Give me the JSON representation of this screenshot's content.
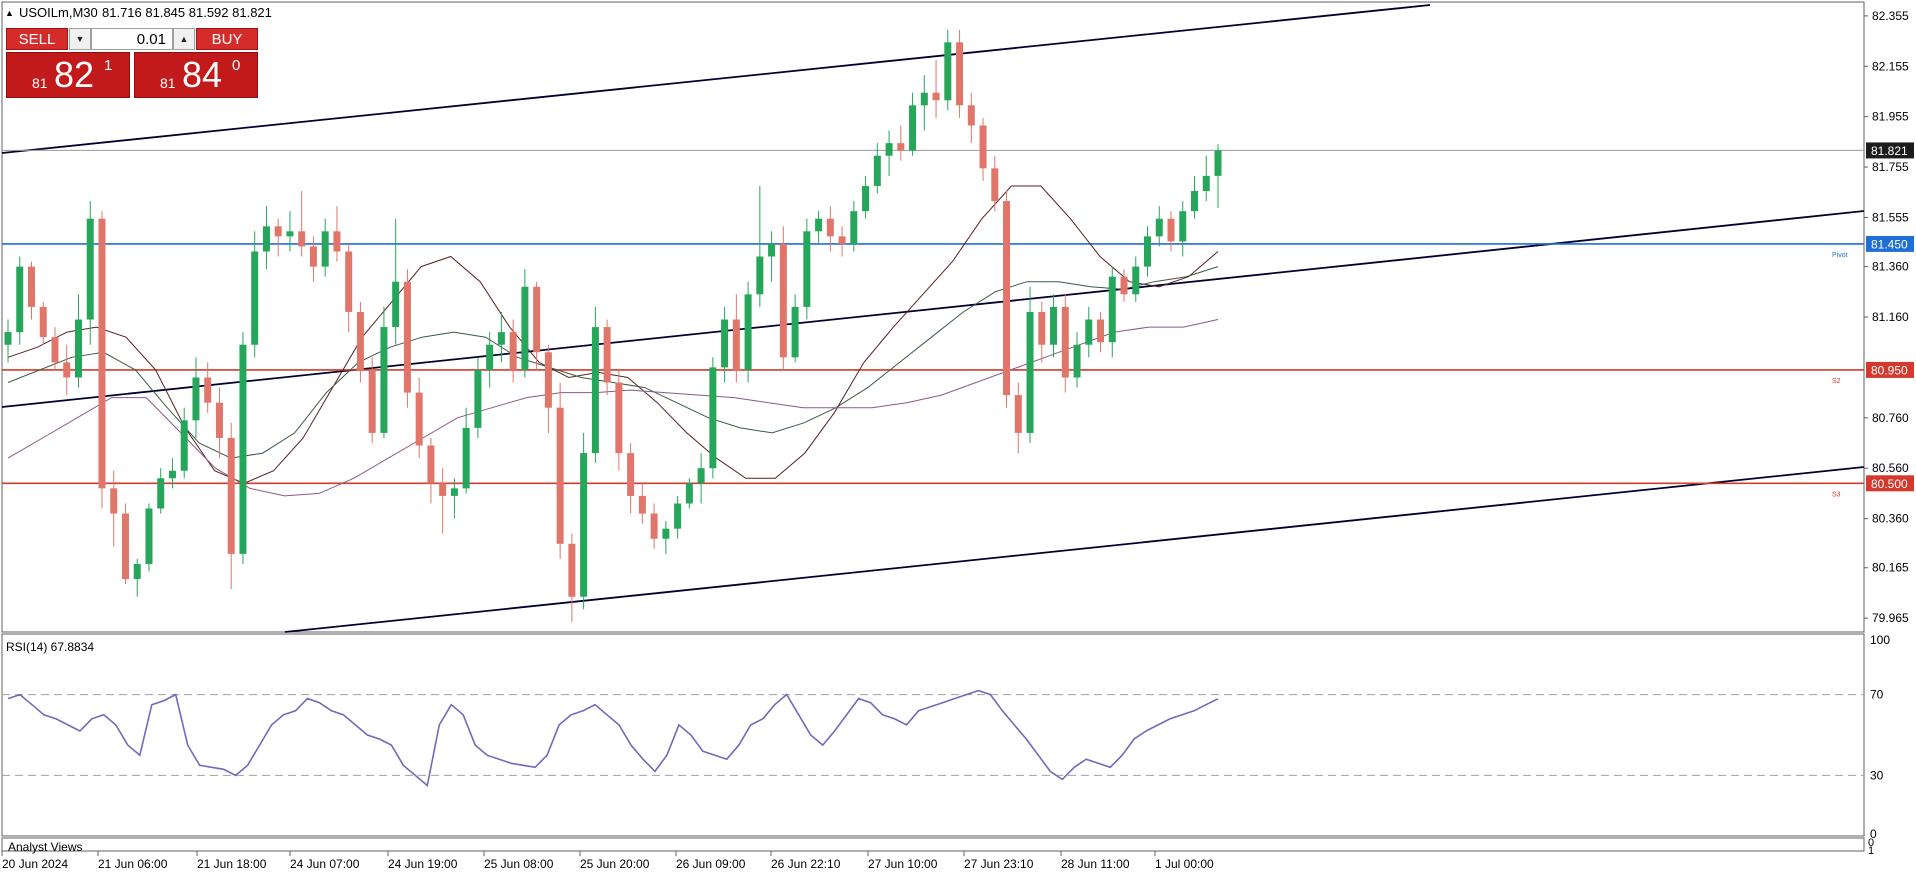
{
  "header": {
    "symbol": "USOILm,M30",
    "ohlc": "81.716 81.845 81.592 81.821"
  },
  "trade_panel": {
    "sell_label": "SELL",
    "buy_label": "BUY",
    "volume": "0.01",
    "sell_price": {
      "small": "81",
      "big": "82",
      "sup": "1"
    },
    "buy_price": {
      "small": "81",
      "big": "84",
      "sup": "0"
    }
  },
  "colors": {
    "bull": "#26a65b",
    "bear": "#e0766a",
    "pivot": "#1f6fd6",
    "support": "#d33a2c",
    "channel": "#000033",
    "ma_fast": "#5a2020",
    "ma_mid": "#3b5a40",
    "ma_slow": "#8a5a86",
    "rsi": "#7767b8"
  },
  "chart_data": [
    {
      "type": "candlestick",
      "x": [
        "20 Jun 2024",
        "21 Jun 06:00",
        "21 Jun 18:00",
        "24 Jun 07:00",
        "24 Jun 19:00",
        "25 Jun 08:00",
        "25 Jun 20:00",
        "26 Jun 09:00",
        "26 Jun 22:10",
        "27 Jun 10:00",
        "27 Jun 23:10",
        "28 Jun 11:00",
        "1 Jul 00:00"
      ],
      "y_ticks": [
        "82.355",
        "82.155",
        "81.955",
        "81.755",
        "81.555",
        "81.360",
        "81.160",
        "80.760",
        "80.560",
        "80.360",
        "80.165",
        "79.965"
      ],
      "ylim": [
        79.91,
        82.41
      ],
      "series": [
        {
          "values": [
            [
              81.05,
              81.15,
              80.98,
              81.1
            ],
            [
              81.1,
              81.4,
              81.05,
              81.36
            ],
            [
              81.36,
              81.38,
              81.15,
              81.2
            ],
            [
              81.2,
              81.22,
              81.05,
              81.08
            ],
            [
              81.08,
              81.12,
              80.95,
              80.98
            ],
            [
              80.98,
              81.05,
              80.85,
              80.92
            ],
            [
              80.92,
              81.25,
              80.88,
              81.15
            ],
            [
              81.15,
              81.62,
              81.05,
              81.55
            ],
            [
              81.55,
              81.58,
              80.4,
              80.48
            ],
            [
              80.48,
              80.55,
              80.25,
              80.38
            ],
            [
              80.38,
              80.42,
              80.1,
              80.12
            ],
            [
              80.12,
              80.2,
              80.05,
              80.18
            ],
            [
              80.18,
              80.42,
              80.15,
              80.4
            ],
            [
              80.4,
              80.56,
              80.38,
              80.52
            ],
            [
              80.52,
              80.6,
              80.48,
              80.55
            ],
            [
              80.55,
              80.8,
              80.52,
              80.75
            ],
            [
              80.75,
              81.0,
              80.68,
              80.92
            ],
            [
              80.92,
              80.98,
              80.78,
              80.82
            ],
            [
              80.82,
              80.88,
              80.6,
              80.68
            ],
            [
              80.68,
              80.74,
              80.08,
              80.22
            ],
            [
              80.22,
              81.1,
              80.18,
              81.05
            ],
            [
              81.05,
              81.5,
              81.0,
              81.42
            ],
            [
              81.42,
              81.6,
              81.35,
              81.52
            ],
            [
              81.52,
              81.55,
              81.4,
              81.48
            ],
            [
              81.48,
              81.58,
              81.42,
              81.5
            ],
            [
              81.5,
              81.66,
              81.4,
              81.44
            ],
            [
              81.44,
              81.48,
              81.3,
              81.36
            ],
            [
              81.36,
              81.55,
              81.32,
              81.5
            ],
            [
              81.5,
              81.6,
              81.38,
              81.42
            ],
            [
              81.42,
              81.45,
              81.1,
              81.18
            ],
            [
              81.18,
              81.22,
              80.9,
              80.95
            ],
            [
              80.95,
              81.0,
              80.66,
              80.7
            ],
            [
              80.7,
              81.2,
              80.68,
              81.12
            ],
            [
              81.12,
              81.55,
              81.05,
              81.3
            ],
            [
              81.3,
              81.35,
              80.8,
              80.86
            ],
            [
              80.86,
              80.92,
              80.6,
              80.65
            ],
            [
              80.65,
              80.68,
              80.42,
              80.5
            ],
            [
              80.5,
              80.56,
              80.3,
              80.45
            ],
            [
              80.45,
              80.52,
              80.36,
              80.48
            ],
            [
              80.48,
              80.8,
              80.46,
              80.72
            ],
            [
              80.72,
              81.0,
              80.68,
              80.95
            ],
            [
              80.95,
              81.1,
              80.88,
              81.05
            ],
            [
              81.05,
              81.18,
              80.98,
              81.1
            ],
            [
              81.1,
              81.15,
              80.9,
              80.95
            ],
            [
              80.95,
              81.35,
              80.92,
              81.28
            ],
            [
              81.28,
              81.3,
              80.95,
              81.02
            ],
            [
              81.02,
              81.05,
              80.7,
              80.8
            ],
            [
              80.8,
              80.9,
              80.2,
              80.26
            ],
            [
              80.26,
              80.3,
              79.95,
              80.05
            ],
            [
              80.05,
              80.7,
              80.0,
              80.62
            ],
            [
              80.62,
              81.2,
              80.58,
              81.12
            ],
            [
              81.12,
              81.15,
              80.85,
              80.9
            ],
            [
              80.9,
              80.95,
              80.55,
              80.62
            ],
            [
              80.62,
              80.66,
              80.38,
              80.45
            ],
            [
              80.45,
              80.5,
              80.34,
              80.38
            ],
            [
              80.38,
              80.42,
              80.24,
              80.28
            ],
            [
              80.28,
              80.35,
              80.22,
              80.32
            ],
            [
              80.32,
              80.45,
              80.28,
              80.42
            ],
            [
              80.42,
              80.52,
              80.4,
              80.5
            ],
            [
              80.5,
              80.62,
              80.42,
              80.56
            ],
            [
              80.56,
              81.0,
              80.52,
              80.96
            ],
            [
              80.96,
              81.2,
              80.9,
              81.15
            ],
            [
              81.15,
              81.25,
              80.9,
              80.95
            ],
            [
              80.95,
              81.3,
              80.9,
              81.25
            ],
            [
              81.25,
              81.68,
              81.2,
              81.4
            ],
            [
              81.4,
              81.5,
              81.3,
              81.45
            ],
            [
              81.45,
              81.52,
              80.95,
              81.0
            ],
            [
              81.0,
              81.25,
              80.98,
              81.2
            ],
            [
              81.2,
              81.55,
              81.15,
              81.5
            ],
            [
              81.5,
              81.58,
              81.45,
              81.55
            ],
            [
              81.55,
              81.6,
              81.42,
              81.48
            ],
            [
              81.48,
              81.52,
              81.4,
              81.45
            ],
            [
              81.45,
              81.62,
              81.42,
              81.58
            ],
            [
              81.58,
              81.72,
              81.55,
              81.68
            ],
            [
              81.68,
              81.85,
              81.65,
              81.8
            ],
            [
              81.8,
              81.9,
              81.72,
              81.85
            ],
            [
              81.85,
              81.92,
              81.78,
              81.82
            ],
            [
              81.82,
              82.05,
              81.8,
              82.0
            ],
            [
              82.0,
              82.12,
              81.9,
              82.05
            ],
            [
              82.05,
              82.18,
              81.95,
              82.02
            ],
            [
              82.02,
              82.3,
              81.98,
              82.25
            ],
            [
              82.25,
              82.3,
              81.95,
              82.0
            ],
            [
              82.0,
              82.05,
              81.85,
              81.92
            ],
            [
              81.92,
              81.95,
              81.7,
              81.75
            ],
            [
              81.75,
              81.8,
              81.58,
              81.62
            ],
            [
              81.62,
              81.66,
              80.8,
              80.85
            ],
            [
              80.85,
              80.9,
              80.62,
              80.7
            ],
            [
              80.7,
              81.28,
              80.66,
              81.18
            ],
            [
              81.18,
              81.22,
              80.98,
              81.05
            ],
            [
              81.05,
              81.25,
              81.0,
              81.2
            ],
            [
              81.2,
              81.25,
              80.86,
              80.92
            ],
            [
              80.92,
              81.1,
              80.88,
              81.05
            ],
            [
              81.05,
              81.2,
              81.0,
              81.15
            ],
            [
              81.15,
              81.18,
              81.02,
              81.06
            ],
            [
              81.06,
              81.36,
              81.0,
              81.32
            ],
            [
              81.32,
              81.35,
              81.22,
              81.25
            ],
            [
              81.25,
              81.4,
              81.22,
              81.36
            ],
            [
              81.36,
              81.52,
              81.32,
              81.48
            ],
            [
              81.48,
              81.6,
              81.44,
              81.55
            ],
            [
              81.55,
              81.58,
              81.42,
              81.46
            ],
            [
              81.46,
              81.62,
              81.4,
              81.58
            ],
            [
              81.58,
              81.72,
              81.55,
              81.66
            ],
            [
              81.66,
              81.8,
              81.62,
              81.72
            ],
            [
              81.72,
              81.845,
              81.592,
              81.821
            ]
          ]
        }
      ],
      "moving_averages": [
        {
          "values": [
            81.0,
            81.04,
            81.1,
            81.12,
            81.08,
            80.95,
            80.72,
            80.55,
            80.5,
            80.55,
            80.68,
            80.88,
            81.08,
            81.22,
            81.36,
            81.4,
            81.3,
            81.12,
            80.98,
            80.92,
            80.94,
            80.92,
            80.82,
            80.7,
            80.6,
            80.52,
            80.52,
            80.62,
            80.78,
            80.98,
            81.12,
            81.25,
            81.38,
            81.55,
            81.68,
            81.68,
            81.55,
            81.4,
            81.3,
            81.28,
            81.32,
            81.42
          ]
        },
        {
          "values": [
            80.9,
            80.95,
            81.0,
            81.02,
            80.95,
            80.8,
            80.66,
            80.6,
            80.62,
            80.7,
            80.86,
            80.98,
            81.04,
            81.08,
            81.1,
            81.08,
            81.0,
            80.96,
            80.92,
            80.9,
            80.88,
            80.82,
            80.76,
            80.72,
            80.7,
            80.74,
            80.8,
            80.88,
            80.98,
            81.08,
            81.18,
            81.26,
            81.3,
            81.3,
            81.28,
            81.27,
            81.3,
            81.32,
            81.36
          ]
        },
        {
          "values": [
            80.6,
            80.68,
            80.76,
            80.84,
            80.84,
            80.7,
            80.56,
            80.48,
            80.45,
            80.46,
            80.52,
            80.6,
            80.68,
            80.76,
            80.8,
            80.84,
            80.86,
            80.86,
            80.87,
            80.86,
            80.85,
            80.84,
            80.82,
            80.8,
            80.8,
            80.8,
            80.82,
            80.85,
            80.9,
            80.95,
            81.0,
            81.05,
            81.1,
            81.12,
            81.12,
            81.15
          ]
        }
      ],
      "lines": {
        "pivot": 81.45,
        "s2": 80.95,
        "s3": 80.5,
        "current": 81.821
      },
      "labels": {
        "pivot": "Pivot",
        "s2": "S2",
        "s3": "S3"
      },
      "price_tags": {
        "current": "81.821",
        "pivot": "81.450",
        "s2": "80.950",
        "s3": "80.500"
      }
    },
    {
      "type": "line",
      "title": "RSI(14) 67.8834",
      "y_ticks": [
        "100",
        "70",
        "30",
        "0"
      ],
      "ylim": [
        0,
        100
      ],
      "levels": [
        70,
        30
      ],
      "series": [
        {
          "values": [
            68,
            70,
            65,
            60,
            58,
            55,
            52,
            58,
            60,
            55,
            45,
            40,
            65,
            67,
            70,
            45,
            35,
            34,
            33,
            30,
            35,
            45,
            55,
            60,
            62,
            68,
            66,
            62,
            60,
            55,
            50,
            48,
            45,
            35,
            30,
            25,
            55,
            65,
            60,
            45,
            40,
            38,
            36,
            35,
            34,
            40,
            55,
            60,
            62,
            65,
            60,
            55,
            45,
            38,
            32,
            40,
            55,
            50,
            42,
            40,
            38,
            45,
            55,
            58,
            65,
            70,
            60,
            50,
            45,
            52,
            60,
            68,
            66,
            60,
            58,
            55,
            62,
            64,
            66,
            68,
            70,
            72,
            70,
            62,
            55,
            48,
            40,
            32,
            28,
            34,
            38,
            36,
            34,
            40,
            48,
            52,
            55,
            58,
            60,
            62,
            65,
            67.9
          ]
        }
      ]
    }
  ],
  "time_labels": [
    "20 Jun 2024",
    "21 Jun 06:00",
    "21 Jun 18:00",
    "24 Jun 07:00",
    "24 Jun 19:00",
    "25 Jun 08:00",
    "25 Jun 20:00",
    "26 Jun 09:00",
    "26 Jun 22:10",
    "27 Jun 10:00",
    "27 Jun 23:10",
    "28 Jun 11:00",
    "1 Jul 00:00"
  ],
  "analyst_panel": {
    "title": "Analyst Views",
    "ticks": [
      "0",
      "1"
    ]
  }
}
